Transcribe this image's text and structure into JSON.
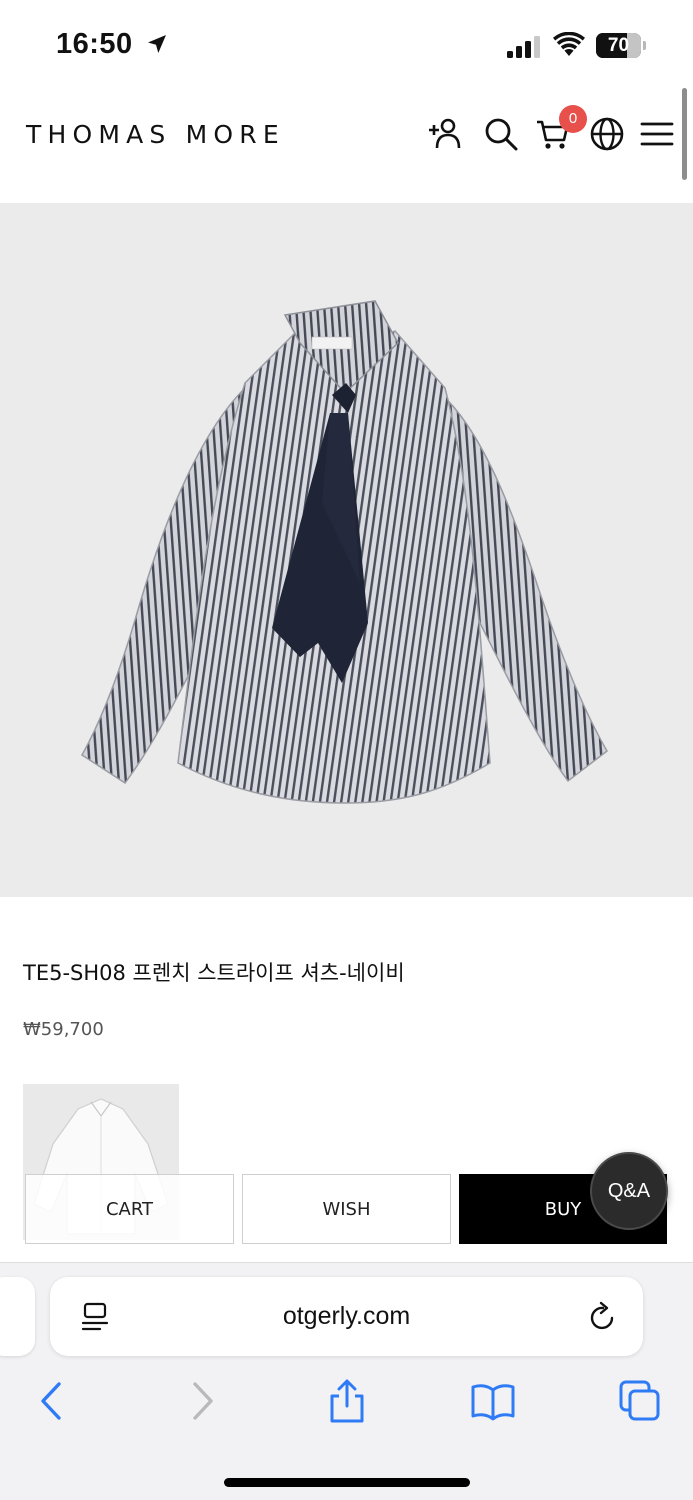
{
  "status_bar": {
    "time": "16:50",
    "battery_level": "70",
    "battery_fraction": 0.7
  },
  "header": {
    "brand": "THOMAS MORE",
    "cart_count": "0",
    "icons": [
      "add-user-icon",
      "search-icon",
      "cart-icon",
      "globe-icon",
      "menu-icon"
    ]
  },
  "product": {
    "title": "TE5-SH08 프렌치 스트라이프 셔츠-네이비",
    "price": "₩59,700"
  },
  "actions": {
    "cart_label": "CART",
    "wish_label": "WISH",
    "buy_label": "BUY",
    "qa_label": "Q&A"
  },
  "browser": {
    "url": "otgerly.com",
    "toolbar_icons": [
      "back-icon",
      "forward-icon",
      "share-icon",
      "bookmarks-icon",
      "tabs-icon"
    ]
  },
  "colors": {
    "accent_blue": "#2f7bf5",
    "badge_red": "#e8504b",
    "hero_bg": "#ebebeb",
    "buy_bg": "#000000"
  }
}
